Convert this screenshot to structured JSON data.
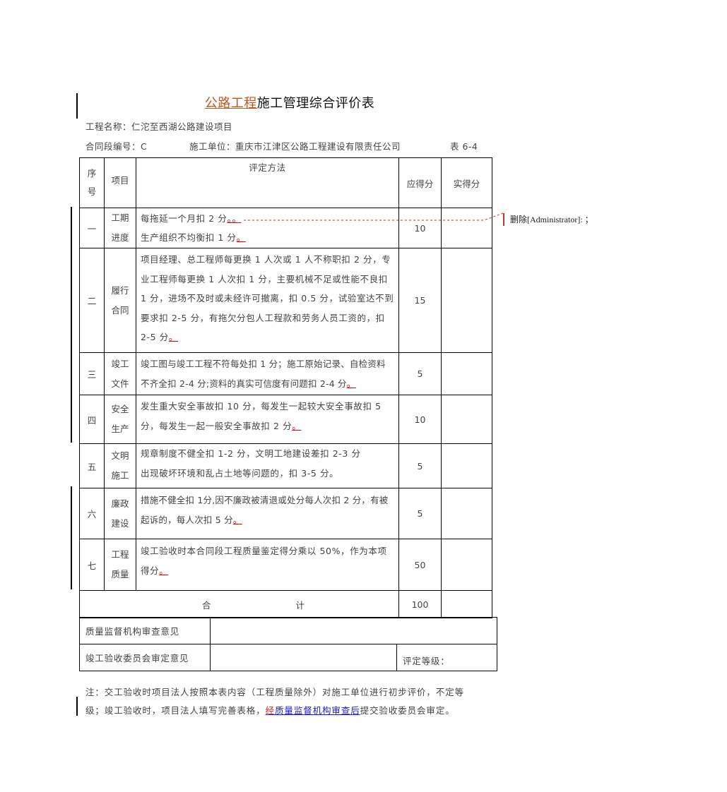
{
  "document": {
    "title_inserted": "公路工程",
    "title_rest": "施工管理综合评价表",
    "project_name_label": "工程名称：",
    "project_name": "仁沱至西湖公路建设项目",
    "contract_label": "合同段编号：",
    "contract_no": "C",
    "contractor_label": "施工单位：",
    "contractor": "重庆市江津区公路工程建设有限责任公司",
    "table_no": "表 6-4"
  },
  "table": {
    "headers": {
      "no": "序号",
      "item": "项目",
      "method": "评定方法",
      "due": "应得分",
      "actual": "实得分"
    },
    "rows": [
      {
        "no": "一",
        "item": "工期进度",
        "method_lines": [
          "每拖延一个月扣 2 分",
          "生产组织不均衡扣 1 分"
        ],
        "marks": [
          "。。",
          "。"
        ],
        "due": "10",
        "actual": ""
      },
      {
        "no": "二",
        "item": "履行合同",
        "method": "项目经理、总工程师每更换 1 人次或 1 人不称职扣 2 分，专业工程师每更换 1 人次扣 1 分，主要机械不足或性能不良扣 1 分，进场不及时或未经许可撤离，扣 0.5 分，试验室达不到要求扣 2-5 分，有拖欠分包人工程款和劳务人员工资的，扣 2-5 分",
        "mark": "。",
        "due": "15",
        "actual": ""
      },
      {
        "no": "三",
        "item": "竣工文件",
        "method": "竣工图与竣工工程不符每处扣 1 分；施工原始记录、自检资料不齐全扣 2-4 分;资料的真实可信度有问题扣 2-4 分",
        "mark": "。",
        "due": "5",
        "actual": ""
      },
      {
        "no": "四",
        "item": "安全生产",
        "method": "发生重大安全事故扣 10 分，每发生一起较大安全事故扣 5 分，每发生一起一般安全事故扣 2 分",
        "mark": "。",
        "due": "10",
        "actual": ""
      },
      {
        "no": "五",
        "item": "文明施工",
        "method_lines": [
          "规章制度不健全扣 1-2 分，文明工地建设差扣 2-3 分",
          "出现破坏环境和乱占土地等问题的，扣 3-5 分。"
        ],
        "due": "5",
        "actual": ""
      },
      {
        "no": "六",
        "item": "廉政建设",
        "method": "措施不健全扣 1分,因不廉政被清退或处分每人次扣 2 分，有被起诉的，每人次扣 5 分",
        "mark": "。",
        "due": "5",
        "actual": ""
      },
      {
        "no": "七",
        "item": "工程质量",
        "method": "竣工验收时本合同段工程质量鉴定得分乘以 50%，作为本项得分",
        "mark": "。",
        "due": "50",
        "actual": ""
      }
    ],
    "total": {
      "label_a": "合",
      "label_b": "计",
      "due": "100",
      "actual": ""
    },
    "review_quality": {
      "label": "质量监督机构审查意见",
      "value": ""
    },
    "review_committee": {
      "label": "竣工验收委员会审定意见",
      "value": "",
      "grade_label": "评定等级："
    }
  },
  "note": {
    "line1": "注：交工验收时项目法人按照本表内容（工程质量除外）对施工单位进行初步评价，不定等",
    "line2_a": "级；竣工验收时，项目法人填写完善表格，",
    "line2_inserted_red": "经",
    "line2_inserted_blue": "质量监督机构审查后",
    "line2_b": "提交验收委员会审定。"
  },
  "comment": {
    "text": "删除[Administrator]: ；",
    "accent": "#c0392b"
  },
  "colors": {
    "insert_orange": "#c0561c",
    "mark_red": "#d00000",
    "insert_blue": "#1a1ad0"
  }
}
